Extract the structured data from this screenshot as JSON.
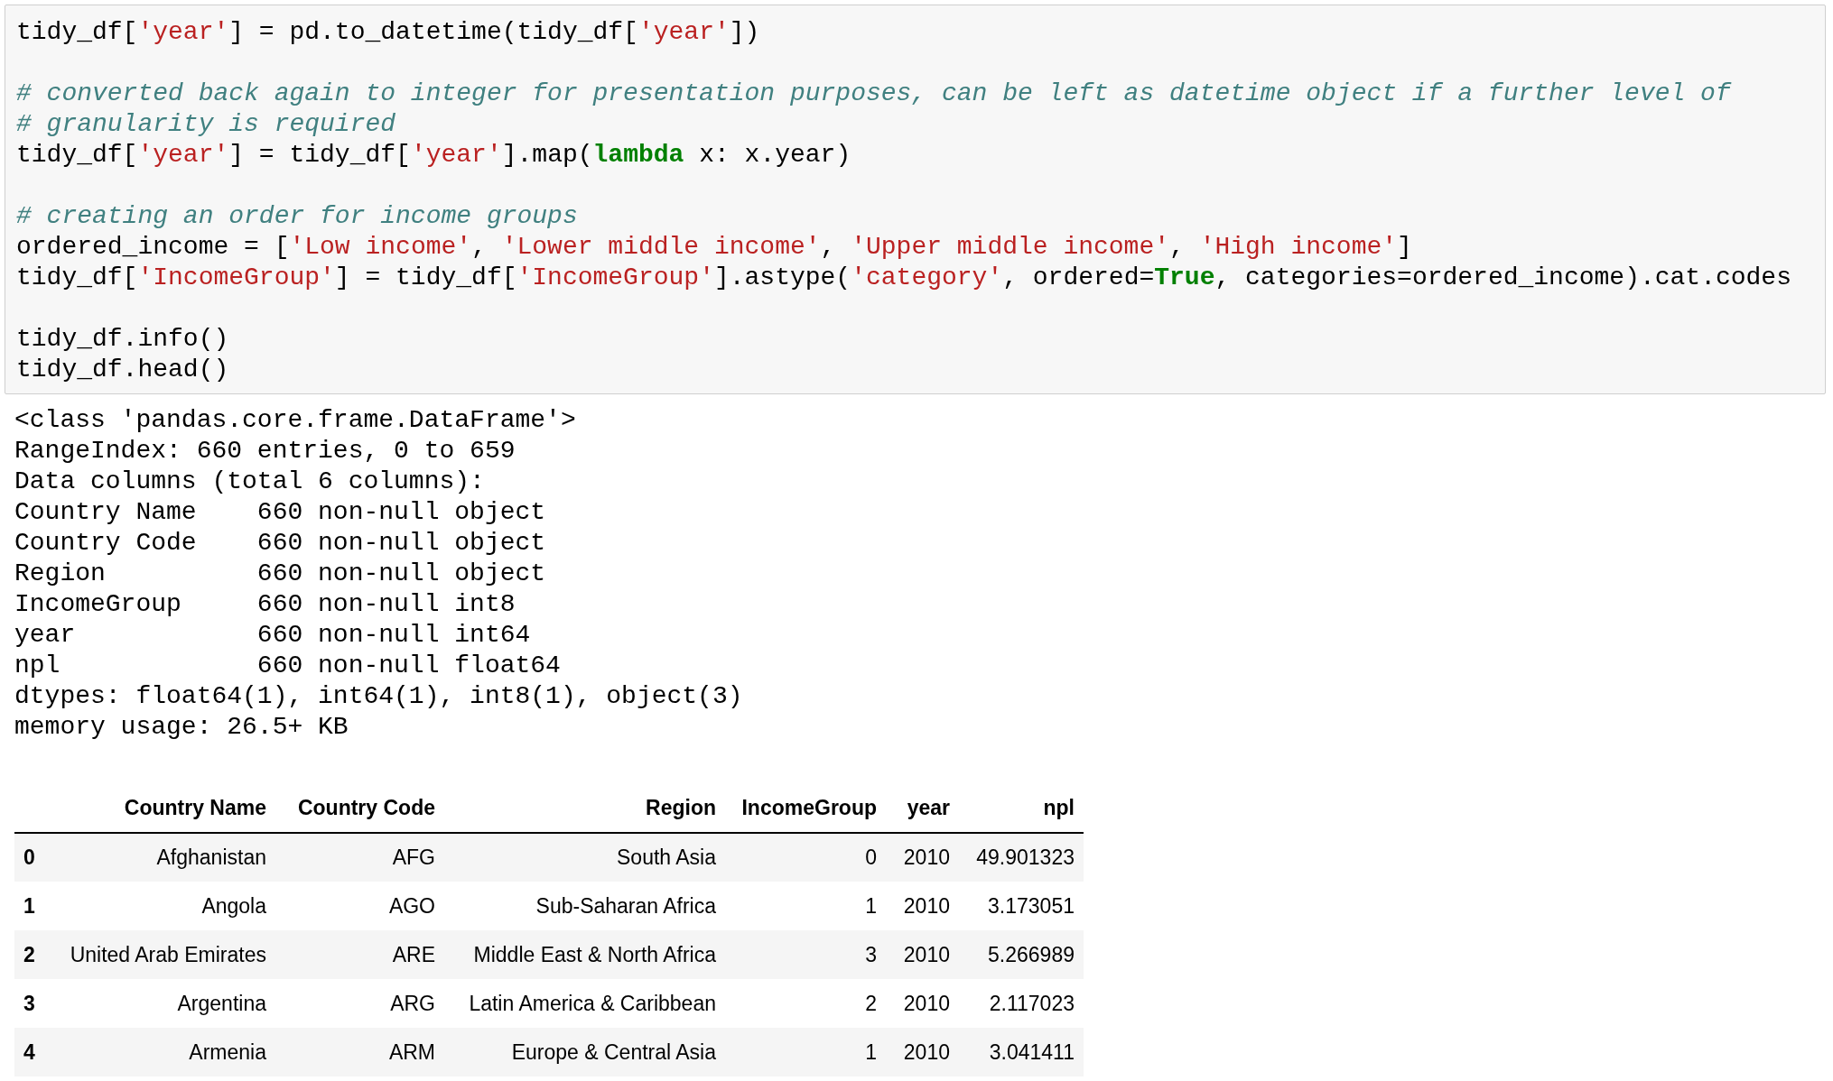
{
  "code_cell": {
    "lines": [
      {
        "tokens": [
          {
            "kind": "plain",
            "text": "tidy_df["
          },
          {
            "kind": "string",
            "text": "'year'"
          },
          {
            "kind": "plain",
            "text": "] = pd.to_datetime(tidy_df["
          },
          {
            "kind": "string",
            "text": "'year'"
          },
          {
            "kind": "plain",
            "text": "])"
          }
        ]
      },
      {
        "kind": "blank"
      },
      {
        "tokens": [
          {
            "kind": "comment",
            "text": "# converted back again to integer for presentation purposes, can be left as datetime object if a further level of"
          }
        ]
      },
      {
        "tokens": [
          {
            "kind": "comment",
            "text": "# granularity is required"
          }
        ]
      },
      {
        "tokens": [
          {
            "kind": "plain",
            "text": "tidy_df["
          },
          {
            "kind": "string",
            "text": "'year'"
          },
          {
            "kind": "plain",
            "text": "] = tidy_df["
          },
          {
            "kind": "string",
            "text": "'year'"
          },
          {
            "kind": "plain",
            "text": "].map("
          },
          {
            "kind": "keyword",
            "text": "lambda"
          },
          {
            "kind": "plain",
            "text": " x: x.year)"
          }
        ]
      },
      {
        "kind": "blank"
      },
      {
        "tokens": [
          {
            "kind": "comment",
            "text": "# creating an order for income groups"
          }
        ]
      },
      {
        "tokens": [
          {
            "kind": "plain",
            "text": "ordered_income = ["
          },
          {
            "kind": "string",
            "text": "'Low income'"
          },
          {
            "kind": "plain",
            "text": ", "
          },
          {
            "kind": "string",
            "text": "'Lower middle income'"
          },
          {
            "kind": "plain",
            "text": ", "
          },
          {
            "kind": "string",
            "text": "'Upper middle income'"
          },
          {
            "kind": "plain",
            "text": ", "
          },
          {
            "kind": "string",
            "text": "'High income'"
          },
          {
            "kind": "plain",
            "text": "]"
          }
        ]
      },
      {
        "tokens": [
          {
            "kind": "plain",
            "text": "tidy_df["
          },
          {
            "kind": "string",
            "text": "'IncomeGroup'"
          },
          {
            "kind": "plain",
            "text": "] = tidy_df["
          },
          {
            "kind": "string",
            "text": "'IncomeGroup'"
          },
          {
            "kind": "plain",
            "text": "].astype("
          },
          {
            "kind": "string",
            "text": "'category'"
          },
          {
            "kind": "plain",
            "text": ", ordered="
          },
          {
            "kind": "keyword",
            "text": "True"
          },
          {
            "kind": "plain",
            "text": ", categories=ordered_income).cat.codes"
          }
        ]
      },
      {
        "kind": "blank"
      },
      {
        "tokens": [
          {
            "kind": "plain",
            "text": "tidy_df.info()"
          }
        ]
      },
      {
        "tokens": [
          {
            "kind": "plain",
            "text": "tidy_df.head()"
          }
        ]
      }
    ]
  },
  "output": {
    "lines": [
      "<class 'pandas.core.frame.DataFrame'>",
      "RangeIndex: 660 entries, 0 to 659",
      "Data columns (total 6 columns):",
      "Country Name    660 non-null object",
      "Country Code    660 non-null object",
      "Region          660 non-null object",
      "IncomeGroup     660 non-null int8",
      "year            660 non-null int64",
      "npl             660 non-null float64",
      "dtypes: float64(1), int64(1), int8(1), object(3)",
      "memory usage: 26.5+ KB"
    ]
  },
  "table": {
    "columns": [
      "Country Name",
      "Country Code",
      "Region",
      "IncomeGroup",
      "year",
      "npl"
    ],
    "rows": [
      {
        "index": "0",
        "cells": [
          "Afghanistan",
          "AFG",
          "South Asia",
          "0",
          "2010",
          "49.901323"
        ]
      },
      {
        "index": "1",
        "cells": [
          "Angola",
          "AGO",
          "Sub-Saharan Africa",
          "1",
          "2010",
          "3.173051"
        ]
      },
      {
        "index": "2",
        "cells": [
          "United Arab Emirates",
          "ARE",
          "Middle East & North Africa",
          "3",
          "2010",
          "5.266989"
        ]
      },
      {
        "index": "3",
        "cells": [
          "Argentina",
          "ARG",
          "Latin America & Caribbean",
          "2",
          "2010",
          "2.117023"
        ]
      },
      {
        "index": "4",
        "cells": [
          "Armenia",
          "ARM",
          "Europe & Central Asia",
          "1",
          "2010",
          "3.041411"
        ]
      }
    ]
  }
}
